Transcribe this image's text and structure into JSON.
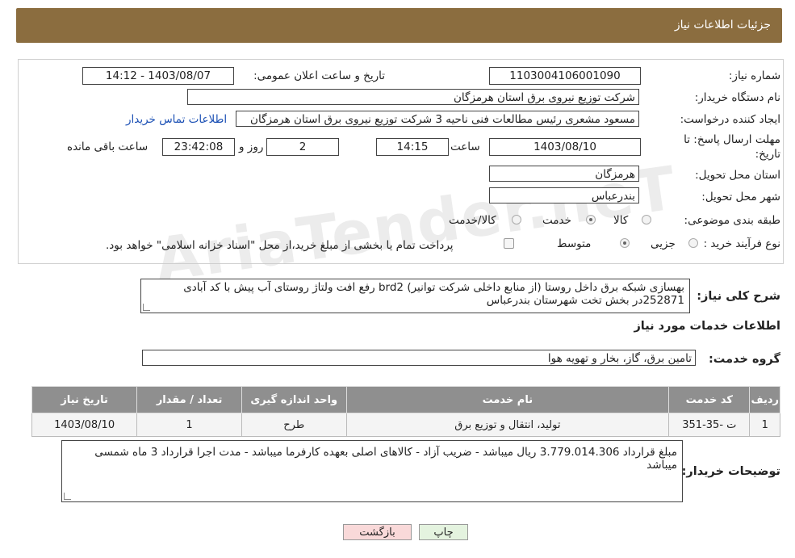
{
  "header": {
    "title": "جزئیات اطلاعات نیاز"
  },
  "form": {
    "need_number_label": "شماره نیاز:",
    "need_number": "1103004106001090",
    "announce_label": "تاریخ و ساعت اعلان عمومی:",
    "announce_value": "1403/08/07 - 14:12",
    "buyer_org_label": "نام دستگاه خریدار:",
    "buyer_org": "شرکت توزیع نیروی برق استان هرمزگان",
    "requester_label": "ایجاد کننده درخواست:",
    "requester": "مسعود مشعری رئیس مطالعات فنی ناحیه 3 شرکت توزیع نیروی برق استان هرمزگان",
    "contact_link": "اطلاعات تماس خریدار",
    "deadline_label_1": "مهلت ارسال پاسخ: تا",
    "deadline_label_2": "تاریخ:",
    "deadline_date": "1403/08/10",
    "time_label": "ساعت",
    "deadline_time": "14:15",
    "days_value": "2",
    "days_label": "روز و",
    "remaining_time": "23:42:08",
    "remaining_label": "ساعت باقی مانده",
    "province_label": "استان محل تحویل:",
    "province": "هرمزگان",
    "city_label": "شهر محل تحویل:",
    "city": "بندرعباس",
    "category_label": "طبقه بندی موضوعی:",
    "category_options": [
      "کالا",
      "خدمت",
      "کالا/خدمت"
    ],
    "category_selected": "خدمت",
    "process_label": "نوع فرآیند خرید :",
    "process_options": [
      "جزیی",
      "متوسط"
    ],
    "process_selected": "متوسط",
    "payment_note": "پرداخت تمام یا بخشی از مبلغ خرید،از محل \"اسناد خزانه اسلامی\" خواهد بود."
  },
  "description": {
    "label": "شرح کلی نیاز:",
    "text": "بهسازی شبکه برق داخل روستا (از منابع داخلی شرکت توانیر) brd2 رفع افت ولتاژ روستای آب پیش با کد آبادی 252871در بخش تخت شهرستان بندرعباس"
  },
  "services": {
    "section_title": "اطلاعات خدمات مورد نیاز",
    "group_label": "گروه خدمت:",
    "group_value": "تامین برق، گاز، بخار و تهویه هوا",
    "columns": [
      "ردیف",
      "کد خدمت",
      "نام خدمت",
      "واحد اندازه گیری",
      "تعداد / مقدار",
      "تاریخ نیاز"
    ],
    "rows": [
      [
        "1",
        "ت -35-351",
        "تولید، انتقال و توزیع برق",
        "طرح",
        "1",
        "1403/08/10"
      ]
    ]
  },
  "buyer_notes": {
    "label": "توضیحات خریدار:",
    "text": "مبلغ قرارداد 3.779.014.306 ریال میباشد - ضریب آزاد - کالاهای اصلی بعهده کارفرما میباشد - مدت اجرا قرارداد 3 ماه شمسی میباشد"
  },
  "buttons": {
    "print": "چاپ",
    "back": "بازگشت"
  },
  "watermark": "AriaTender.neT",
  "colors": {
    "header": "#8b6d3f",
    "back_button": "#f9d9d9",
    "print_button": "#e4f3df"
  }
}
